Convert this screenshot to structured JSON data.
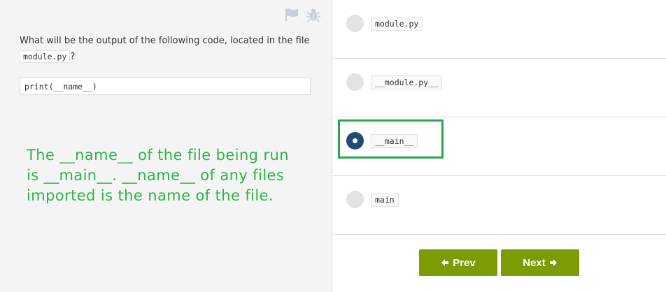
{
  "left": {
    "toolbar_icons": [
      "flag-icon",
      "bug-icon"
    ],
    "question_text": "What will be the output of the following code, located in the file ",
    "question_file": "module.py",
    "question_suffix": "?",
    "code": "print(__name__)",
    "annotation": "The __name__ of the file being run is __main__. __name__ of any files imported is the name of the file."
  },
  "options": [
    {
      "label": "module.py",
      "selected": false
    },
    {
      "label": "__module.py__",
      "selected": false
    },
    {
      "label": "__main__",
      "selected": true
    },
    {
      "label": "main",
      "selected": false
    }
  ],
  "nav": {
    "prev_label": "Prev",
    "next_label": "Next"
  },
  "colors": {
    "button": "#7b9c05",
    "selected_radio": "#224a78",
    "annotation": "#2db44a"
  }
}
